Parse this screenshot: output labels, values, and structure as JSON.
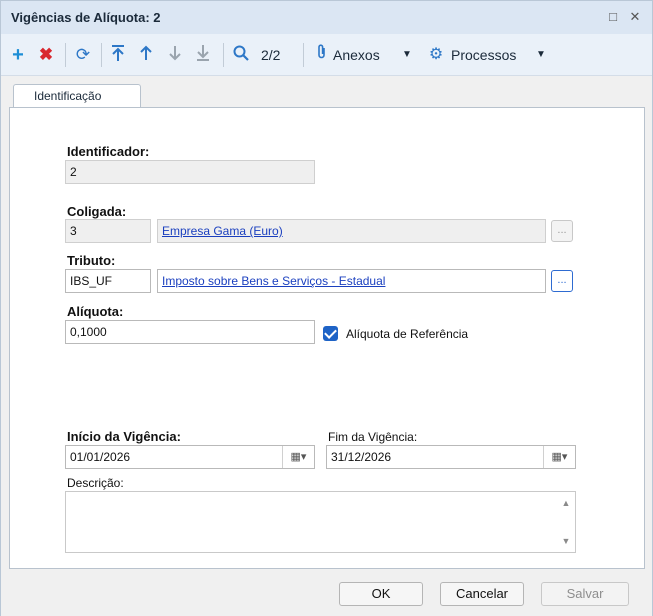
{
  "window": {
    "title": "Vigências de Alíquota: 2",
    "maximize_glyph": "□",
    "close_glyph": "✕"
  },
  "toolbar": {
    "add_icon": "plus-icon",
    "delete_icon": "delete-x-icon",
    "refresh_icon": "refresh-icon",
    "first_icon": "first-record-icon",
    "prev_icon": "previous-record-icon",
    "next_icon": "next-record-icon",
    "last_icon": "last-record-icon",
    "search_icon": "search-icon",
    "record_position": "2/2",
    "anexos_label": "Anexos",
    "processos_label": "Processos"
  },
  "tabs": [
    {
      "label": "Identificação",
      "active": true
    }
  ],
  "form": {
    "identificador_label": "Identificador:",
    "identificador_value": "2",
    "coligada_label": "Coligada:",
    "coligada_code": "3",
    "coligada_name": "Empresa Gama (Euro)",
    "tributo_label": "Tributo:",
    "tributo_code": "IBS_UF",
    "tributo_name": "Imposto sobre Bens e Serviços - Estadual",
    "aliquota_label": "Alíquota:",
    "aliquota_value": "0,1000",
    "aliquota_ref_label": "Alíquota de Referência",
    "aliquota_ref_checked": true,
    "inicio_label": "Início da Vigência:",
    "inicio_value": "01/01/2026",
    "fim_label": "Fim da Vigência:",
    "fim_value": "31/12/2026",
    "descricao_label": "Descrição:",
    "descricao_value": "",
    "ellipsis": "..."
  },
  "footer": {
    "ok_label": "OK",
    "cancel_label": "Cancelar",
    "save_label": "Salvar"
  },
  "colors": {
    "titlebar_bg": "#dbe6f3",
    "toolbar_bg": "#eaf1f9",
    "add_green": "#1d8ed6",
    "delete_red": "#d9272e",
    "icon_blue": "#2d77c7",
    "link_blue": "#1a3fbf",
    "checkbox_blue": "#1e63c6"
  }
}
